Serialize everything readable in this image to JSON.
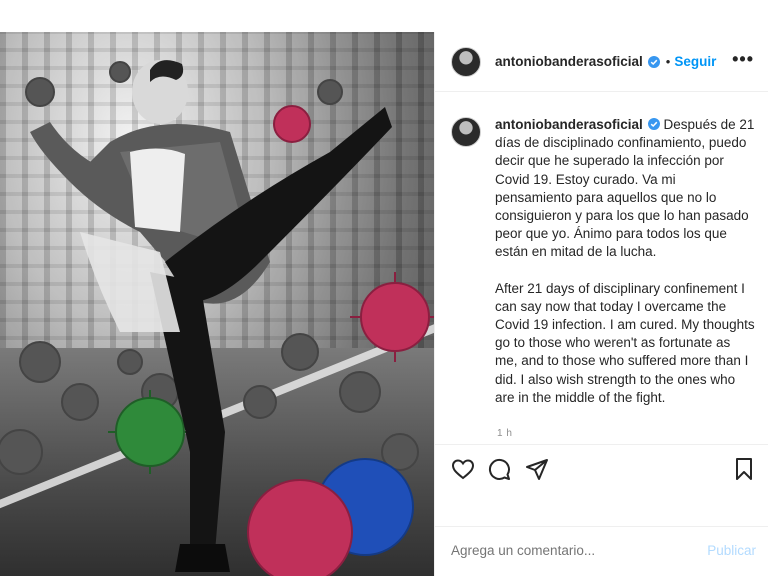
{
  "post": {
    "username": "antoniobanderasoficial",
    "follow_label": "Seguir",
    "separator": "•",
    "more_label": "•••",
    "caption_es": "Después de 21 días de disciplinado confinamiento, puedo decir que he superado la infección por Covid 19. Estoy curado. Va mi pensamiento para aquellos que no lo consiguieron y para los que lo han pasado peor que yo. Ánimo para todos los que están en mitad de la lucha.",
    "caption_en": "After 21 days of disciplinary confinement I can say now that today I overcame the Covid 19 infection. I am cured. My thoughts go to those who weren't as fortunate as me, and to those who suffered more than I did. I also wish strength to the ones who are in the middle of the fight.",
    "timestamp": "1 h"
  },
  "actions": {
    "like_icon": "heart-icon",
    "comment_icon": "comment-icon",
    "share_icon": "share-icon",
    "save_icon": "bookmark-icon"
  },
  "comment_box": {
    "placeholder": "Agrega un comentario...",
    "publish_label": "Publicar"
  },
  "colors": {
    "link_blue": "#0095f6",
    "publish_disabled": "#b3dbff",
    "verified_blue": "#3897f0",
    "muted_text": "#8e8e8e",
    "virus_red": "#c0305a",
    "virus_blue": "#1f4fb8",
    "virus_green": "#2f8a3a"
  }
}
